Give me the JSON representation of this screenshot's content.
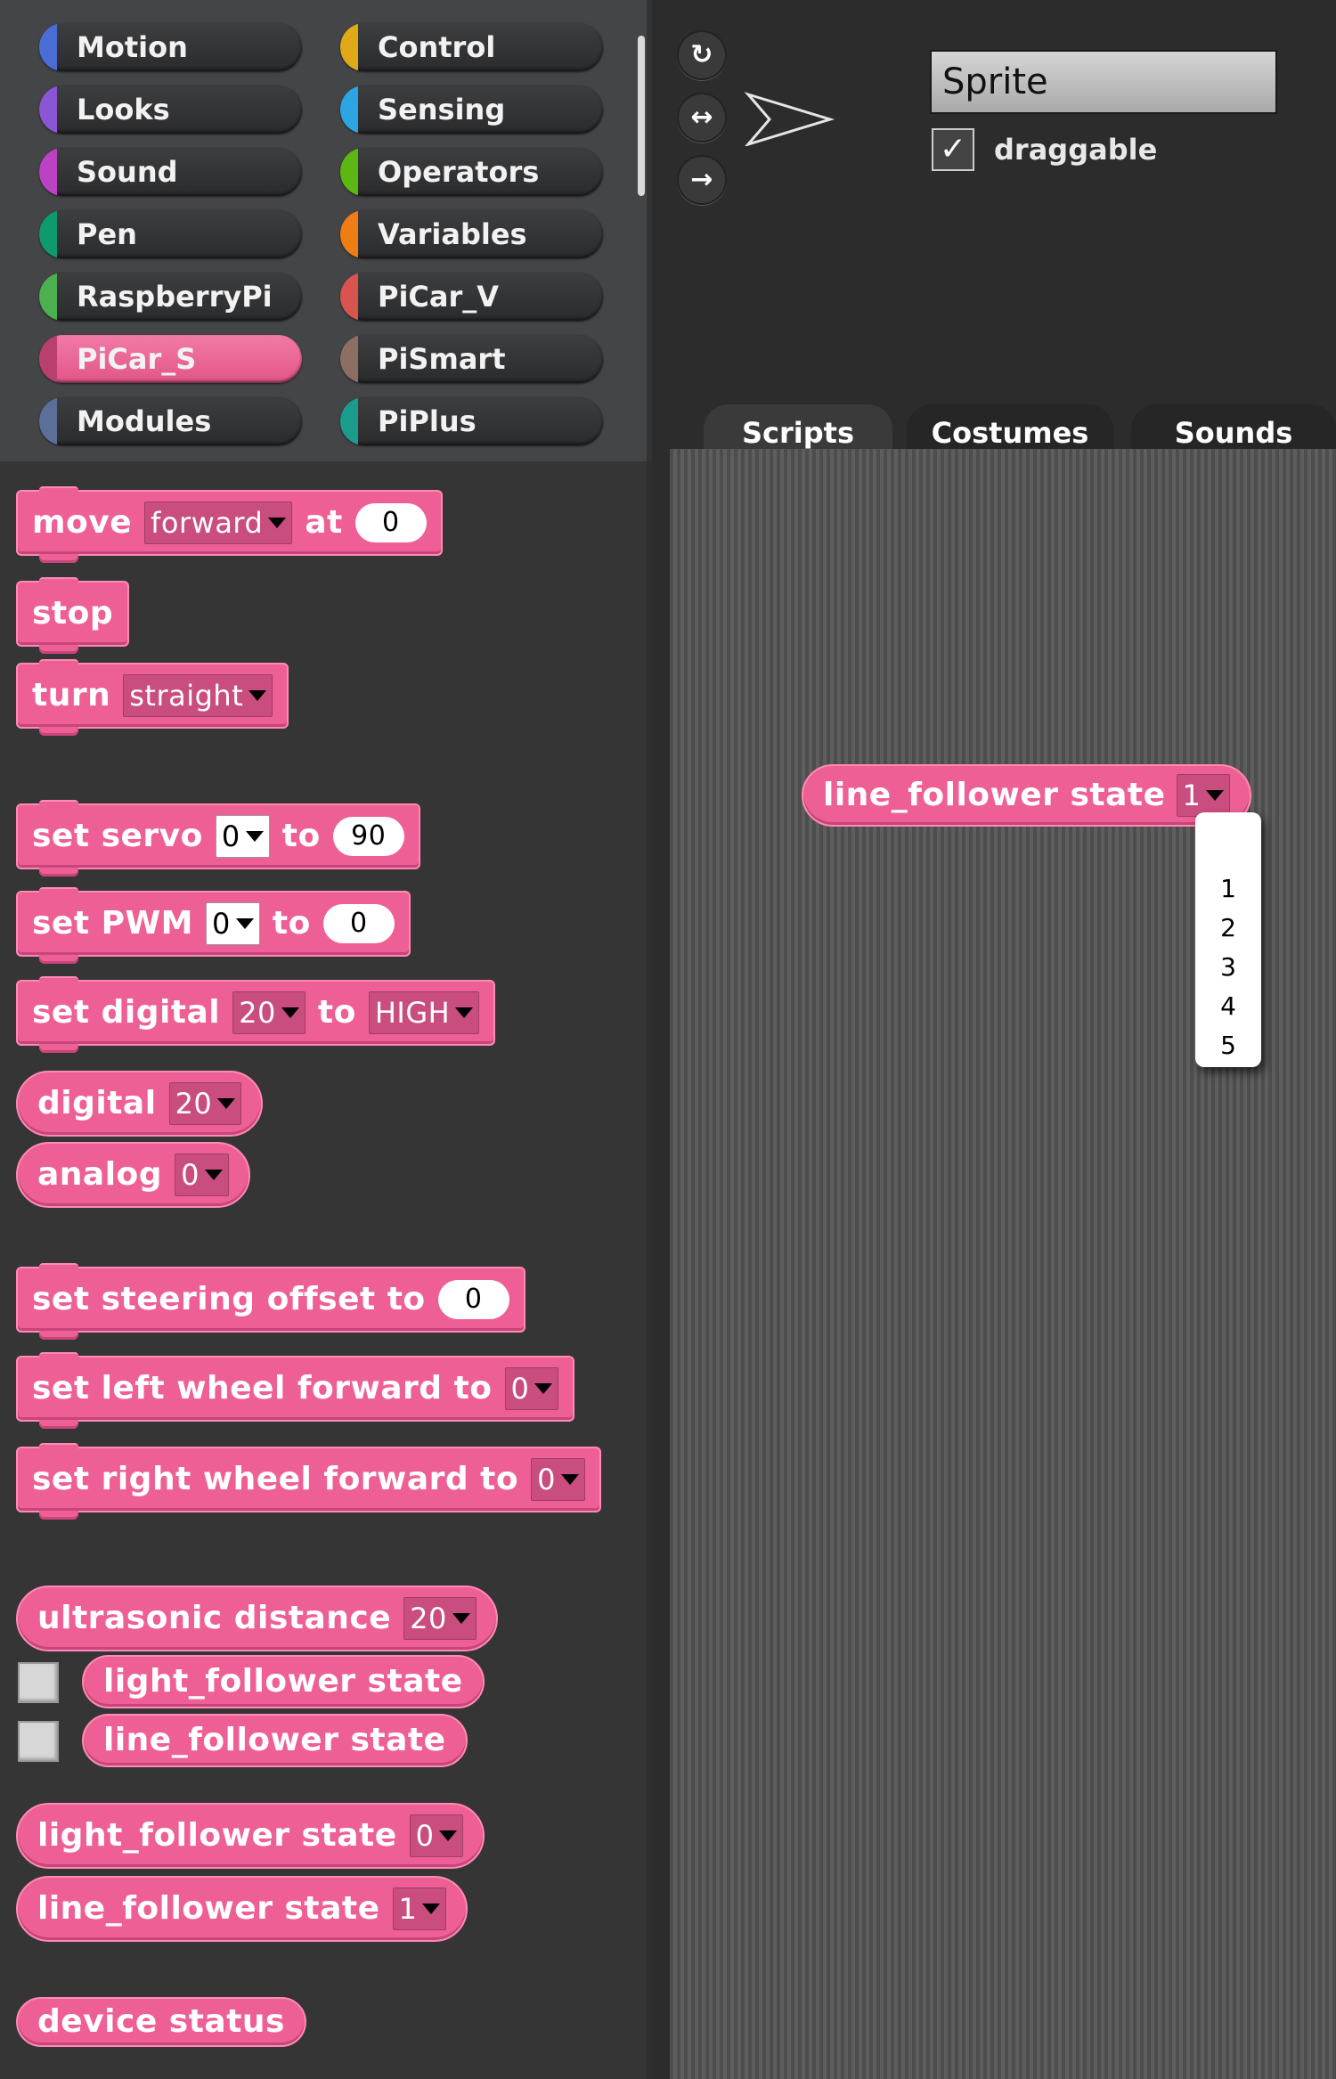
{
  "categories": [
    {
      "label": "Motion",
      "color": "#4a6cd4"
    },
    {
      "label": "Control",
      "color": "#e1a91a"
    },
    {
      "label": "Looks",
      "color": "#8a55d7"
    },
    {
      "label": "Sensing",
      "color": "#2ca5e2"
    },
    {
      "label": "Sound",
      "color": "#bb42c3"
    },
    {
      "label": "Operators",
      "color": "#5cb712"
    },
    {
      "label": "Pen",
      "color": "#0e9a6c"
    },
    {
      "label": "Variables",
      "color": "#ee7d16"
    },
    {
      "label": "RaspberryPi",
      "color": "#4caf50"
    },
    {
      "label": "PiCar_V",
      "color": "#d9534f"
    },
    {
      "label": "PiCar_S",
      "color": "#ee5f95"
    },
    {
      "label": "PiSmart",
      "color": "#8d6e63"
    },
    {
      "label": "Modules",
      "color": "#5b6f99"
    },
    {
      "label": "PiPlus",
      "color": "#1a9b8b"
    }
  ],
  "palette": {
    "move": {
      "label": "move",
      "dropdown": "forward",
      "at": "at",
      "value": "0"
    },
    "stop": {
      "label": "stop"
    },
    "turn": {
      "label": "turn",
      "dropdown": "straight"
    },
    "set_servo": {
      "label": "set servo",
      "dropdown": "0",
      "to": "to",
      "value": "90"
    },
    "set_pwm": {
      "label": "set PWM",
      "dropdown": "0",
      "to": "to",
      "value": "0"
    },
    "set_digital": {
      "label": "set digital",
      "dropdown": "20",
      "to": "to",
      "value": "HIGH"
    },
    "digital": {
      "label": "digital",
      "dropdown": "20"
    },
    "analog": {
      "label": "analog",
      "dropdown": "0"
    },
    "steering": {
      "label": "set steering offset to",
      "value": "0"
    },
    "left_wheel": {
      "label": "set left wheel forward to",
      "dropdown": "0"
    },
    "right_wheel": {
      "label": "set right wheel forward to",
      "dropdown": "0"
    },
    "ultrasonic": {
      "label": "ultrasonic distance",
      "dropdown": "20"
    },
    "light_state_chk": {
      "label": "light_follower state"
    },
    "line_state_chk": {
      "label": "line_follower state"
    },
    "light_state": {
      "label": "light_follower state",
      "dropdown": "0"
    },
    "line_state": {
      "label": "line_follower state",
      "dropdown": "1"
    },
    "device_status": {
      "label": "device status"
    }
  },
  "sprite": {
    "buttons": [
      "↻",
      "↔",
      "→"
    ],
    "name": "Sprite",
    "draggable_check": "✓",
    "draggable_label": "draggable"
  },
  "tabs": [
    "Scripts",
    "Costumes",
    "Sounds"
  ],
  "script_block": {
    "label": "line_follower state",
    "dropdown": "1"
  },
  "menu_items": [
    "1",
    "2",
    "3",
    "4",
    "5"
  ]
}
